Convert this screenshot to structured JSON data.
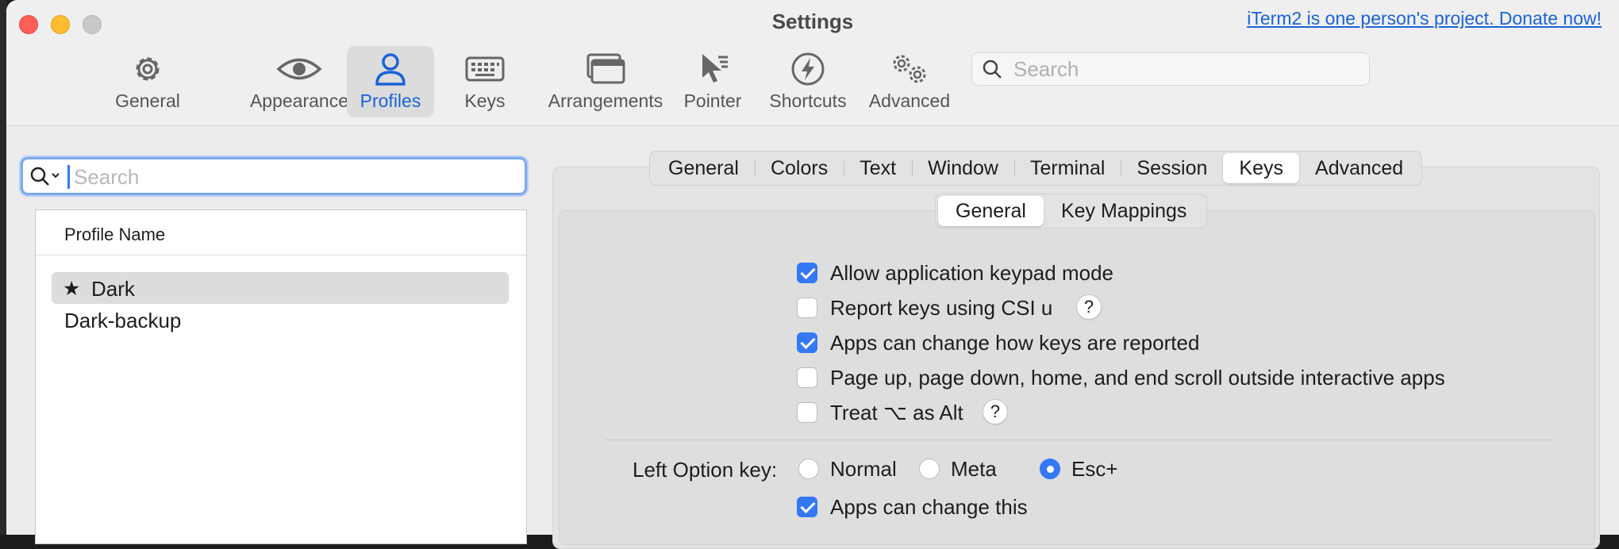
{
  "window": {
    "title": "Settings",
    "donate_link": "iTerm2 is one person's project. Donate now!"
  },
  "toolbar": {
    "items": [
      {
        "label": "General",
        "icon": "gear-icon"
      },
      {
        "label": "Appearance",
        "icon": "eye-icon"
      },
      {
        "label": "Profiles",
        "icon": "person-icon",
        "selected": true
      },
      {
        "label": "Keys",
        "icon": "keyboard-icon"
      },
      {
        "label": "Arrangements",
        "icon": "windows-icon"
      },
      {
        "label": "Pointer",
        "icon": "pointer-icon"
      },
      {
        "label": "Shortcuts",
        "icon": "bolt-icon"
      },
      {
        "label": "Advanced",
        "icon": "gears-icon"
      }
    ],
    "search_placeholder": "Search"
  },
  "profiles": {
    "search_placeholder": "Search",
    "column_header": "Profile Name",
    "rows": [
      {
        "name": "Dark",
        "default": true,
        "selected": true
      },
      {
        "name": "Dark-backup",
        "default": false,
        "selected": false
      }
    ]
  },
  "tabs": [
    "General",
    "Colors",
    "Text",
    "Window",
    "Terminal",
    "Session",
    "Keys",
    "Advanced"
  ],
  "selected_tab": "Keys",
  "subtabs": [
    "General",
    "Key Mappings"
  ],
  "selected_subtab": "General",
  "options": [
    {
      "label": "Allow application keypad mode",
      "checked": true,
      "help": false
    },
    {
      "label": "Report keys using CSI u",
      "checked": false,
      "help": true
    },
    {
      "label": "Apps can change how keys are reported",
      "checked": true,
      "help": false
    },
    {
      "label": "Page up, page down, home, and end scroll outside interactive apps",
      "checked": false,
      "help": false
    },
    {
      "label": "Treat ⌥ as Alt",
      "checked": false,
      "help": true
    }
  ],
  "help_glyph": "?",
  "left_option": {
    "label": "Left Option key:",
    "choices": [
      "Normal",
      "Meta",
      "Esc+"
    ],
    "selected": "Esc+"
  },
  "apps_can_change_this": {
    "label": "Apps can change this",
    "checked": true
  },
  "colors": {
    "accent": "#3478f6",
    "link": "#1a63d8",
    "close": "#ff5f57",
    "minimize": "#febc2e"
  }
}
